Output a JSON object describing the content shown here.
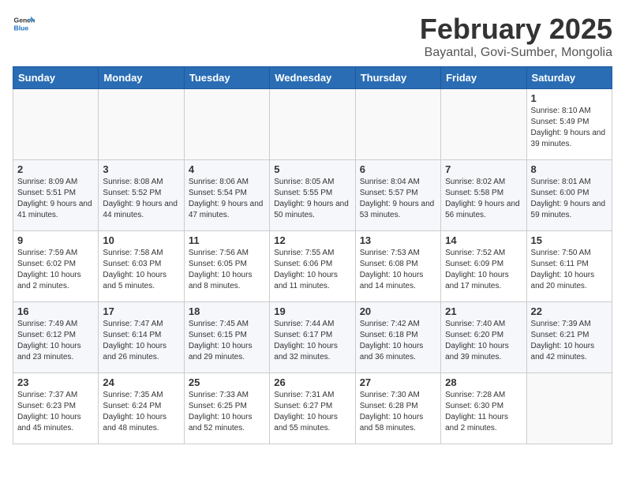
{
  "header": {
    "logo_general": "General",
    "logo_blue": "Blue",
    "title": "February 2025",
    "subtitle": "Bayantal, Govi-Sumber, Mongolia"
  },
  "days_of_week": [
    "Sunday",
    "Monday",
    "Tuesday",
    "Wednesday",
    "Thursday",
    "Friday",
    "Saturday"
  ],
  "weeks": [
    {
      "days": [
        {
          "num": "",
          "info": ""
        },
        {
          "num": "",
          "info": ""
        },
        {
          "num": "",
          "info": ""
        },
        {
          "num": "",
          "info": ""
        },
        {
          "num": "",
          "info": ""
        },
        {
          "num": "",
          "info": ""
        },
        {
          "num": "1",
          "info": "Sunrise: 8:10 AM\nSunset: 5:49 PM\nDaylight: 9 hours and 39 minutes."
        }
      ]
    },
    {
      "days": [
        {
          "num": "2",
          "info": "Sunrise: 8:09 AM\nSunset: 5:51 PM\nDaylight: 9 hours and 41 minutes."
        },
        {
          "num": "3",
          "info": "Sunrise: 8:08 AM\nSunset: 5:52 PM\nDaylight: 9 hours and 44 minutes."
        },
        {
          "num": "4",
          "info": "Sunrise: 8:06 AM\nSunset: 5:54 PM\nDaylight: 9 hours and 47 minutes."
        },
        {
          "num": "5",
          "info": "Sunrise: 8:05 AM\nSunset: 5:55 PM\nDaylight: 9 hours and 50 minutes."
        },
        {
          "num": "6",
          "info": "Sunrise: 8:04 AM\nSunset: 5:57 PM\nDaylight: 9 hours and 53 minutes."
        },
        {
          "num": "7",
          "info": "Sunrise: 8:02 AM\nSunset: 5:58 PM\nDaylight: 9 hours and 56 minutes."
        },
        {
          "num": "8",
          "info": "Sunrise: 8:01 AM\nSunset: 6:00 PM\nDaylight: 9 hours and 59 minutes."
        }
      ]
    },
    {
      "days": [
        {
          "num": "9",
          "info": "Sunrise: 7:59 AM\nSunset: 6:02 PM\nDaylight: 10 hours and 2 minutes."
        },
        {
          "num": "10",
          "info": "Sunrise: 7:58 AM\nSunset: 6:03 PM\nDaylight: 10 hours and 5 minutes."
        },
        {
          "num": "11",
          "info": "Sunrise: 7:56 AM\nSunset: 6:05 PM\nDaylight: 10 hours and 8 minutes."
        },
        {
          "num": "12",
          "info": "Sunrise: 7:55 AM\nSunset: 6:06 PM\nDaylight: 10 hours and 11 minutes."
        },
        {
          "num": "13",
          "info": "Sunrise: 7:53 AM\nSunset: 6:08 PM\nDaylight: 10 hours and 14 minutes."
        },
        {
          "num": "14",
          "info": "Sunrise: 7:52 AM\nSunset: 6:09 PM\nDaylight: 10 hours and 17 minutes."
        },
        {
          "num": "15",
          "info": "Sunrise: 7:50 AM\nSunset: 6:11 PM\nDaylight: 10 hours and 20 minutes."
        }
      ]
    },
    {
      "days": [
        {
          "num": "16",
          "info": "Sunrise: 7:49 AM\nSunset: 6:12 PM\nDaylight: 10 hours and 23 minutes."
        },
        {
          "num": "17",
          "info": "Sunrise: 7:47 AM\nSunset: 6:14 PM\nDaylight: 10 hours and 26 minutes."
        },
        {
          "num": "18",
          "info": "Sunrise: 7:45 AM\nSunset: 6:15 PM\nDaylight: 10 hours and 29 minutes."
        },
        {
          "num": "19",
          "info": "Sunrise: 7:44 AM\nSunset: 6:17 PM\nDaylight: 10 hours and 32 minutes."
        },
        {
          "num": "20",
          "info": "Sunrise: 7:42 AM\nSunset: 6:18 PM\nDaylight: 10 hours and 36 minutes."
        },
        {
          "num": "21",
          "info": "Sunrise: 7:40 AM\nSunset: 6:20 PM\nDaylight: 10 hours and 39 minutes."
        },
        {
          "num": "22",
          "info": "Sunrise: 7:39 AM\nSunset: 6:21 PM\nDaylight: 10 hours and 42 minutes."
        }
      ]
    },
    {
      "days": [
        {
          "num": "23",
          "info": "Sunrise: 7:37 AM\nSunset: 6:23 PM\nDaylight: 10 hours and 45 minutes."
        },
        {
          "num": "24",
          "info": "Sunrise: 7:35 AM\nSunset: 6:24 PM\nDaylight: 10 hours and 48 minutes."
        },
        {
          "num": "25",
          "info": "Sunrise: 7:33 AM\nSunset: 6:25 PM\nDaylight: 10 hours and 52 minutes."
        },
        {
          "num": "26",
          "info": "Sunrise: 7:31 AM\nSunset: 6:27 PM\nDaylight: 10 hours and 55 minutes."
        },
        {
          "num": "27",
          "info": "Sunrise: 7:30 AM\nSunset: 6:28 PM\nDaylight: 10 hours and 58 minutes."
        },
        {
          "num": "28",
          "info": "Sunrise: 7:28 AM\nSunset: 6:30 PM\nDaylight: 11 hours and 2 minutes."
        },
        {
          "num": "",
          "info": ""
        }
      ]
    }
  ]
}
